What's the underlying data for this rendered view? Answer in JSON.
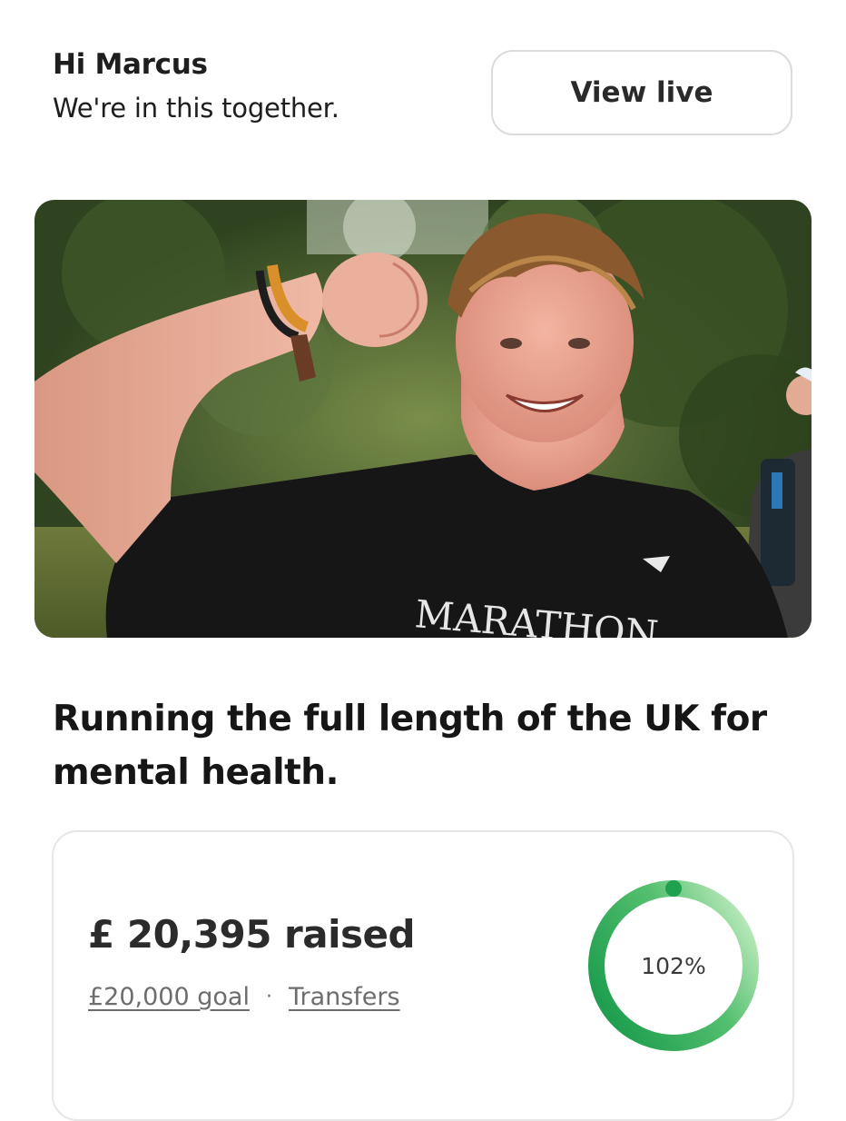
{
  "header": {
    "greeting": "Hi Marcus",
    "tagline": "We're in this together.",
    "view_live_label": "View live"
  },
  "hero": {
    "shirt_text": "MARATHON"
  },
  "campaign": {
    "title": "Running the full length of the UK for mental health."
  },
  "fundraising": {
    "raised_label": "£ 20,395 raised",
    "goal_label": "£20,000 goal",
    "separator": "·",
    "transfers_label": "Transfers",
    "progress_text": "102%",
    "progress_fraction": 1.0198,
    "colors": {
      "ring_dark": "#1fa14f",
      "ring_light": "#c7efc6"
    }
  }
}
